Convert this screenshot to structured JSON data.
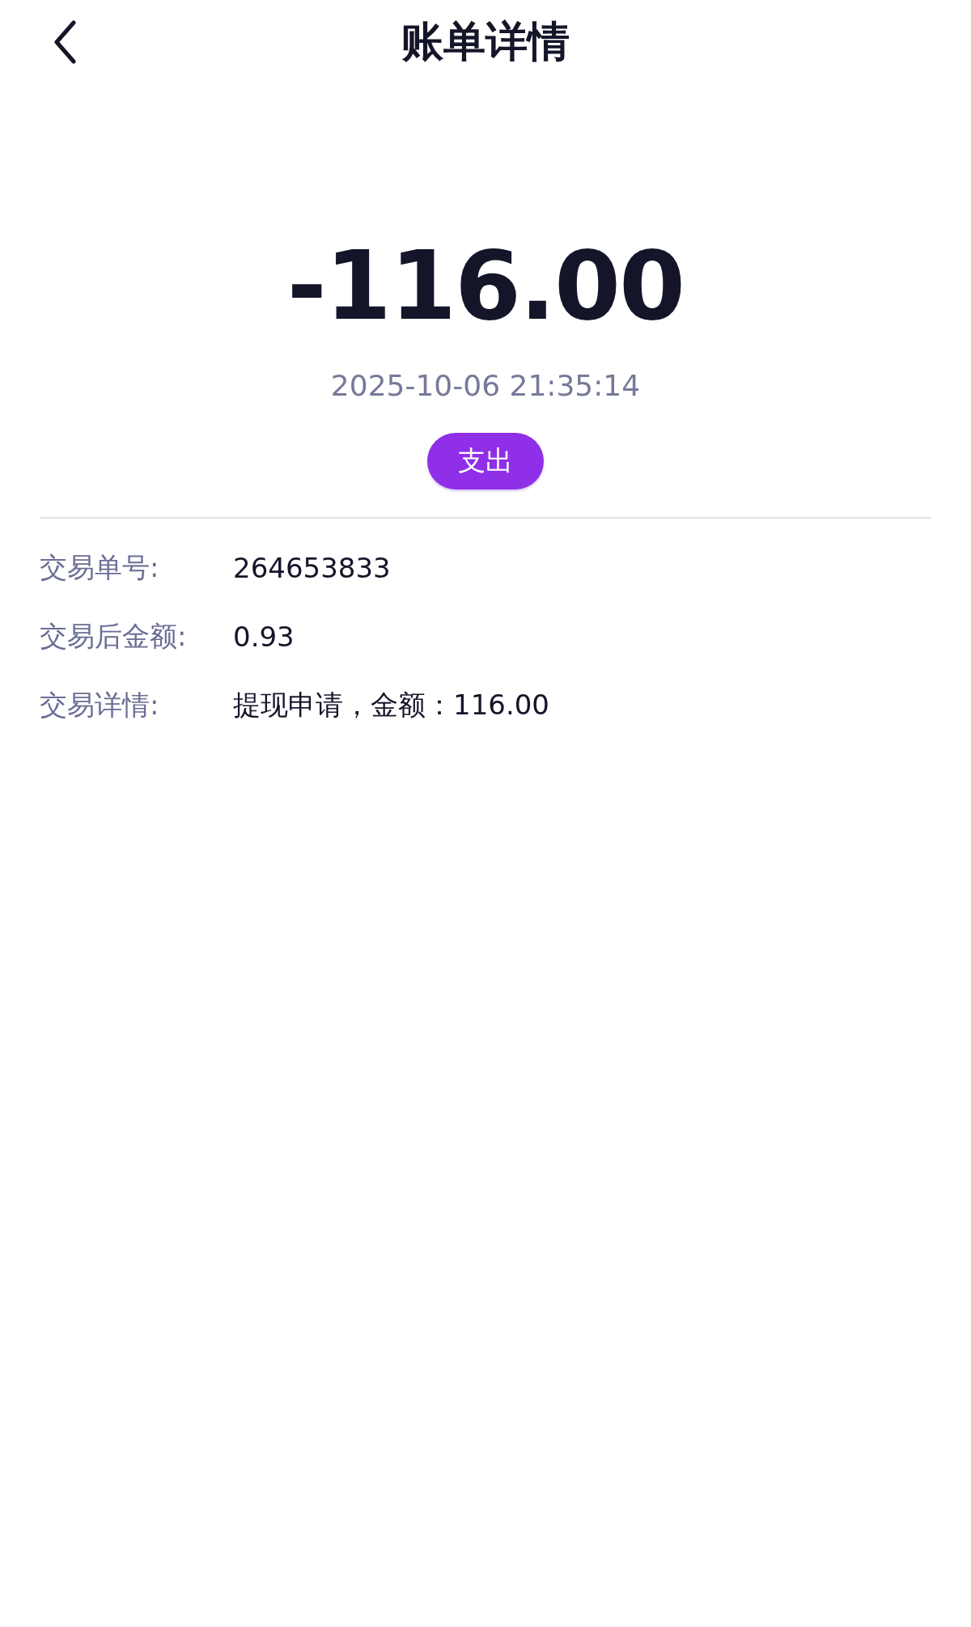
{
  "header": {
    "title": "账单详情"
  },
  "summary": {
    "amount": "-116.00",
    "time": "2025-10-06 21:35:14",
    "type_tag": "支出"
  },
  "details": [
    {
      "label": "交易单号:",
      "value": "264653833"
    },
    {
      "label": "交易后金额:",
      "value": "0.93"
    },
    {
      "label": "交易详情:",
      "value": "提现申请，金额：116.00"
    }
  ]
}
